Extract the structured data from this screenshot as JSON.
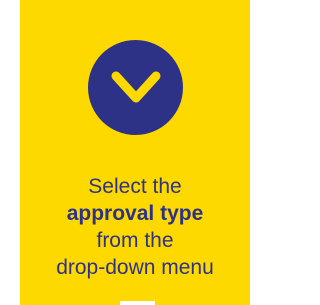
{
  "card": {
    "icon": "chevron-down-icon",
    "lines": [
      "Select the",
      "approval type",
      "from the",
      "drop-down menu"
    ]
  },
  "colors": {
    "background": "#fdd900",
    "accent": "#2e3287",
    "icon_stroke": "#fdd900"
  }
}
